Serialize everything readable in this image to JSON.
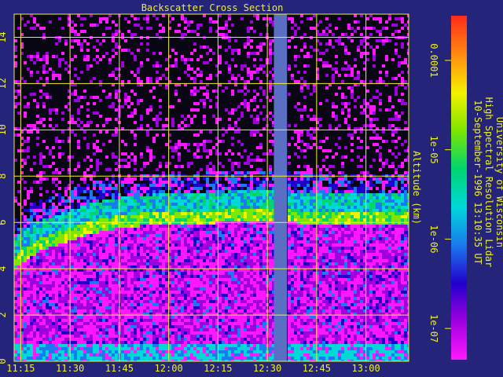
{
  "chart_data": {
    "type": "heatmap",
    "title": "Backscatter Cross Section",
    "ylabel": "Altitude (km)",
    "x_ticks": [
      "11:15",
      "11:30",
      "11:45",
      "12:00",
      "12:15",
      "12:30",
      "12:45",
      "13:00"
    ],
    "y_ticks": [
      "0",
      "2",
      "4",
      "6",
      "8",
      "10",
      "12",
      "14"
    ],
    "xlim": [
      "11:13",
      "13:13"
    ],
    "ylim": [
      0,
      15
    ],
    "grid": true,
    "data_gap": {
      "start": "12:32",
      "end": "12:36"
    },
    "features": {
      "cloud_layer_top_km": [
        4.1,
        4.8,
        5.3,
        5.7,
        5.9,
        6.0,
        6.0,
        6.1,
        6.1,
        6.0,
        6.0
      ],
      "cloud_layer_times": [
        "11:13",
        "11:20",
        "11:30",
        "11:40",
        "11:50",
        "12:00",
        "12:10",
        "12:20",
        "12:30",
        "12:45",
        "13:13"
      ]
    },
    "colorbar": {
      "scale": "log",
      "ticks": [
        "0.0001",
        "1e-05",
        "1e-06",
        "1e-07"
      ],
      "colors": [
        "#ff2a1a",
        "#ff8a10",
        "#f6f000",
        "#7ee600",
        "#00d470",
        "#00d8d8",
        "#1a7af0",
        "#2200cc",
        "#a000e0",
        "#ff18ff"
      ]
    },
    "credits": [
      "University of Wisconsin",
      "High Spectral Resolution Lidar",
      "10-September-1996 13:10:35 UT"
    ]
  }
}
